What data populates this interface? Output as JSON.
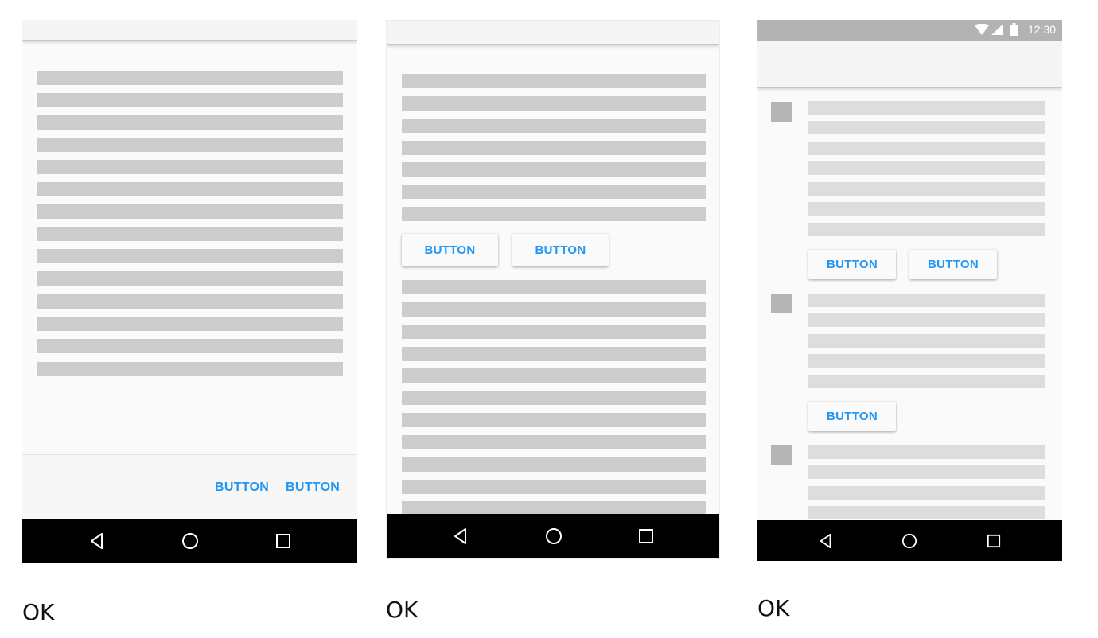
{
  "screens": [
    {
      "caption": "OK",
      "footer_buttons": [
        "BUTTON",
        "BUTTON"
      ]
    },
    {
      "caption": "OK",
      "inline_buttons": [
        "BUTTON",
        "BUTTON"
      ]
    },
    {
      "caption": "OK",
      "status_time": "12:30",
      "card1_buttons": [
        "BUTTON",
        "BUTTON"
      ],
      "card2_buttons": [
        "BUTTON"
      ]
    }
  ],
  "icons": {
    "back": "back-triangle-icon",
    "home": "home-circle-icon",
    "recents": "recents-square-icon",
    "wifi": "wifi-icon",
    "signal": "signal-icon",
    "battery": "battery-icon"
  },
  "colors": {
    "accent": "#2196f3",
    "placeholder_line": "#cccccc",
    "navbar": "#000000",
    "status_bar": "#b3b3b3"
  }
}
